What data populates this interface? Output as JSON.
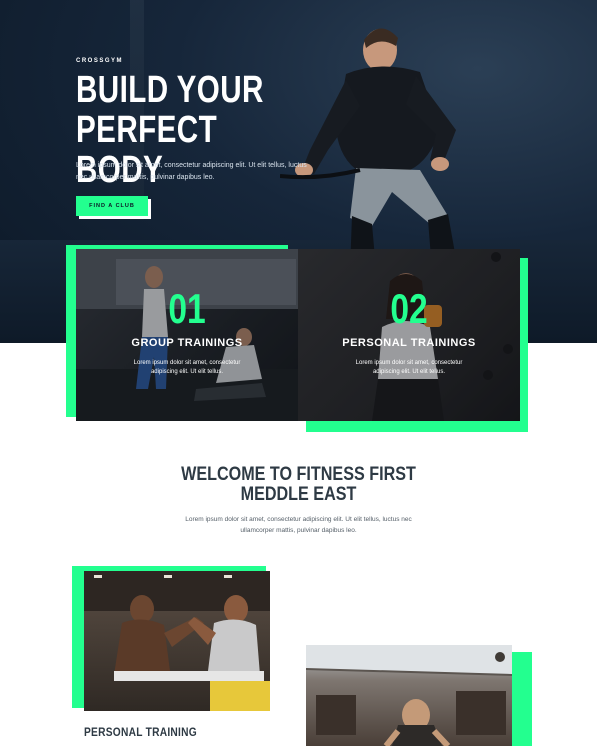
{
  "hero": {
    "brand": "CROSSGYM",
    "title_line1": "BUILD YOUR",
    "title_line2": "PERFECT BODY",
    "text": "Lorem ipsum dolor sit amet, consectetur adipiscing elit. Ut elit tellus, luctus nec ullamcorper mattis, pulvinar dapibus leo.",
    "button_label": "FIND A CLUB"
  },
  "cards": [
    {
      "number": "01",
      "title": "GROUP TRAININGS",
      "text": "Lorem ipsum dolor sit amet, consectetur adipiscing elit. Ut elit tellus."
    },
    {
      "number": "02",
      "title": "PERSONAL TRAININGS",
      "text": "Lorem ipsum dolor sit amet, consectetur adipiscing elit. Ut elit tellus."
    }
  ],
  "welcome": {
    "title_line1": "WELCOME TO FITNESS FIRST",
    "title_line2": "MEDDLE EAST",
    "text": "Lorem ipsum dolor sit amet, consectetur adipiscing elit. Ut elit tellus, luctus nec ullamcorper mattis, pulvinar dapibus leo."
  },
  "features": {
    "personal_training_title": "PERSONAL TRAINING"
  },
  "colors": {
    "accent": "#23ff8f",
    "hero_bg": "#16263a",
    "heading": "#2e3a44"
  }
}
